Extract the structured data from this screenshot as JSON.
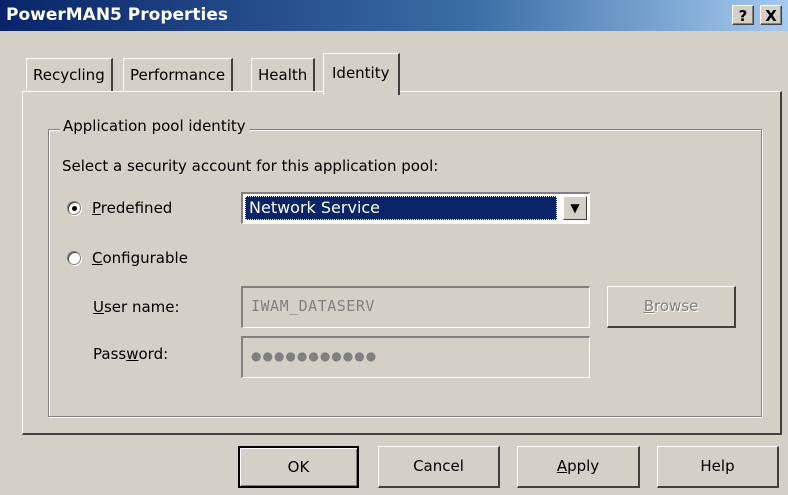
{
  "window": {
    "title": "PowerMAN5 Properties",
    "help_glyph": "?",
    "close_glyph": "X"
  },
  "tabs": [
    {
      "label": "Recycling",
      "active": false
    },
    {
      "label": "Performance",
      "active": false
    },
    {
      "label": "Health",
      "active": false
    },
    {
      "label": "Identity",
      "active": true
    }
  ],
  "identity": {
    "group_label": "Application pool identity",
    "instruction": "Select a security account for this application pool:",
    "predefined": {
      "mnemonic": "P",
      "label_rest": "redefined",
      "selected": true,
      "value": "Network Service"
    },
    "configurable": {
      "mnemonic": "C",
      "label_rest": "onfigurable",
      "selected": false
    },
    "user_name": {
      "mnemonic": "U",
      "label_rest": "ser name:",
      "value": "IWAM_DATASERV",
      "enabled": false
    },
    "password": {
      "label_before": "Pass",
      "mnemonic": "w",
      "label_after": "ord:",
      "value": "●●●●●●●●●●●",
      "enabled": false
    },
    "browse": {
      "mnemonic": "B",
      "label_rest": "rowse",
      "enabled": false
    }
  },
  "footer": {
    "ok": "OK",
    "cancel": "Cancel",
    "apply_mnemonic": "A",
    "apply_rest": "pply",
    "help": "Help"
  },
  "colors": {
    "dialog_bg": "#d4d0c8",
    "title_gradient_start": "#0a246a",
    "selection": "#0a246a",
    "disabled_text": "#808080"
  }
}
